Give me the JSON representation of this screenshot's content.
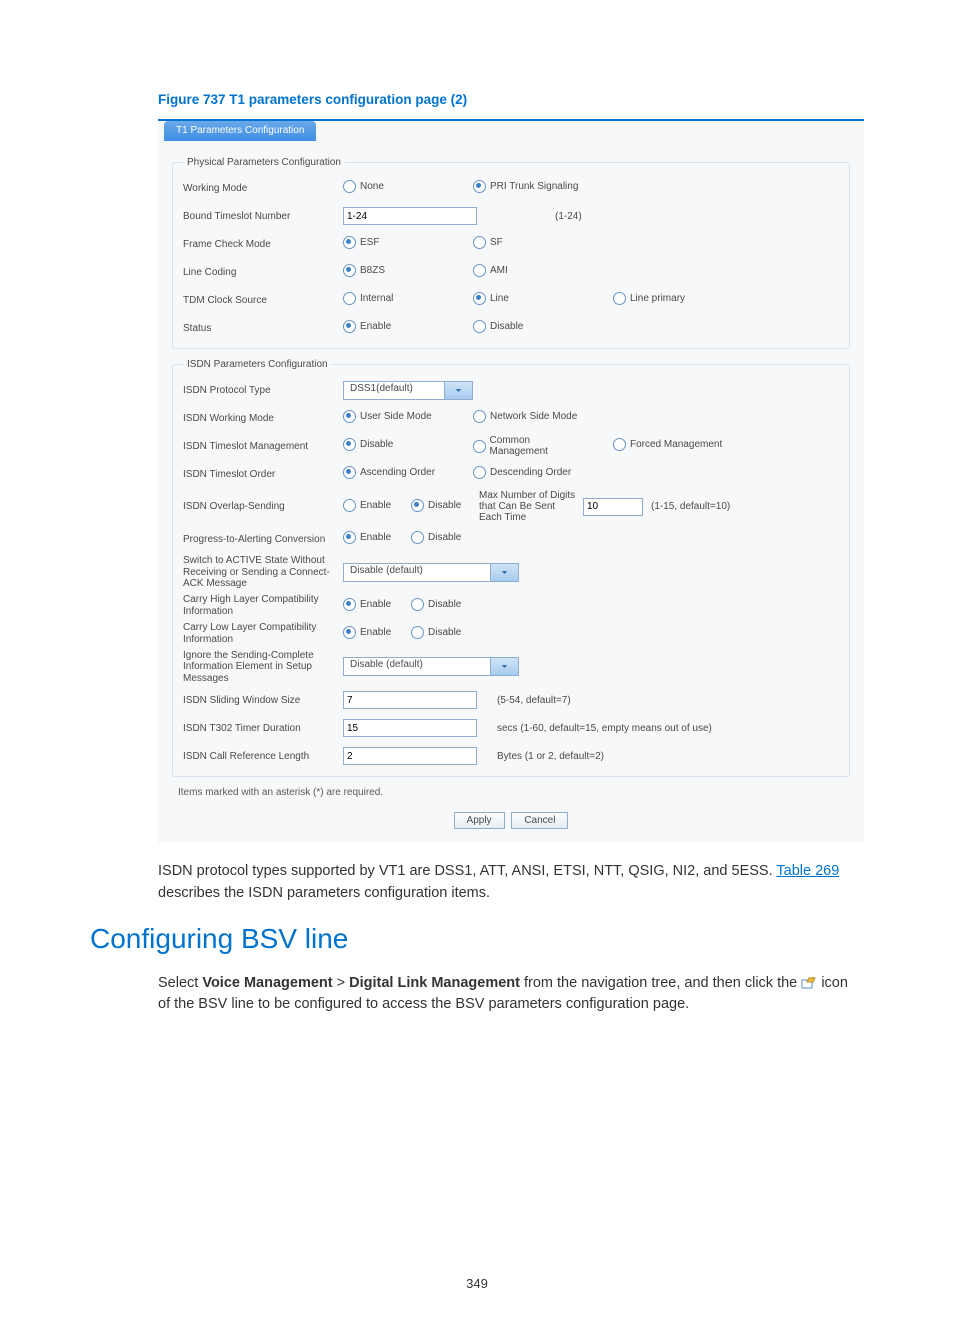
{
  "figure_title": "Figure 737 T1 parameters configuration page (2)",
  "tab_title": "T1 Parameters Configuration",
  "phys": {
    "legend": "Physical Parameters Configuration",
    "working_mode": {
      "label": "Working Mode",
      "opts": [
        "None",
        "PRI Trunk Signaling"
      ],
      "sel": 1
    },
    "bound_ts": {
      "label": "Bound Timeslot Number",
      "value": "1-24",
      "hint": "(1-24)"
    },
    "frame_check": {
      "label": "Frame Check Mode",
      "opts": [
        "ESF",
        "SF"
      ],
      "sel": 0
    },
    "line_coding": {
      "label": "Line Coding",
      "opts": [
        "B8ZS",
        "AMI"
      ],
      "sel": 0
    },
    "tdm_clock": {
      "label": "TDM Clock Source",
      "opts": [
        "Internal",
        "Line",
        "Line primary"
      ],
      "sel": 1
    },
    "status": {
      "label": "Status",
      "opts": [
        "Enable",
        "Disable"
      ],
      "sel": 0
    }
  },
  "isdn": {
    "legend": "ISDN Parameters Configuration",
    "proto": {
      "label": "ISDN Protocol Type",
      "value": "DSS1(default)"
    },
    "working": {
      "label": "ISDN Working Mode",
      "opts": [
        "User Side Mode",
        "Network Side Mode"
      ],
      "sel": 0
    },
    "tsmgmt": {
      "label": "ISDN Timeslot Management",
      "opts": [
        "Disable",
        "Common Management",
        "Forced Management"
      ],
      "sel": 0
    },
    "tsorder": {
      "label": "ISDN Timeslot Order",
      "opts": [
        "Ascending Order",
        "Descending Order"
      ],
      "sel": 0
    },
    "overlap": {
      "label": "ISDN Overlap-Sending",
      "opts": [
        "Enable",
        "Disable"
      ],
      "sel": 1,
      "maxlabel": "Max Number of Digits that Can Be Sent Each Time",
      "maxval": "10",
      "maxhint": "(1-15, default=10)"
    },
    "p2a": {
      "label": "Progress-to-Alerting Conversion",
      "opts": [
        "Enable",
        "Disable"
      ],
      "sel": 0
    },
    "switch_active": {
      "label": "Switch to ACTIVE State Without Receiving or Sending a Connect-ACK Message",
      "value": "Disable (default)"
    },
    "chlc": {
      "label": "Carry High Layer Compatibility Information",
      "opts": [
        "Enable",
        "Disable"
      ],
      "sel": 0
    },
    "cllc": {
      "label": "Carry Low Layer Compatibility Information",
      "opts": [
        "Enable",
        "Disable"
      ],
      "sel": 0
    },
    "ignore_sc": {
      "label": "Ignore the Sending-Complete Information Element in Setup Messages",
      "value": "Disable (default)"
    },
    "sws": {
      "label": "ISDN Sliding Window Size",
      "value": "7",
      "hint": "(5-54, default=7)"
    },
    "t302": {
      "label": "ISDN T302 Timer Duration",
      "value": "15",
      "hint": "secs (1-60, default=15, empty means out of use)"
    },
    "crl": {
      "label": "ISDN Call Reference Length",
      "value": "2",
      "hint": "Bytes (1 or 2, default=2)"
    }
  },
  "footnote": "Items marked with an asterisk (*) are required.",
  "buttons": {
    "apply": "Apply",
    "cancel": "Cancel"
  },
  "narr1_a": "ISDN protocol types supported by VT1 are DSS1, ATT, ANSI, ETSI, NTT, QSIG, NI2, and 5ESS. ",
  "narr1_link": "Table 269",
  "narr1_b": " describes the ISDN parameters configuration items.",
  "h2": "Configuring BSV line",
  "narr2_a": "Select ",
  "narr2_b1": "Voice Management",
  "narr2_gt": " > ",
  "narr2_b2": "Digital Link Management",
  "narr2_c": " from the navigation tree, and then click the ",
  "narr2_d": " icon of the BSV line to be configured to access the BSV parameters configuration page.",
  "page_number": "349"
}
